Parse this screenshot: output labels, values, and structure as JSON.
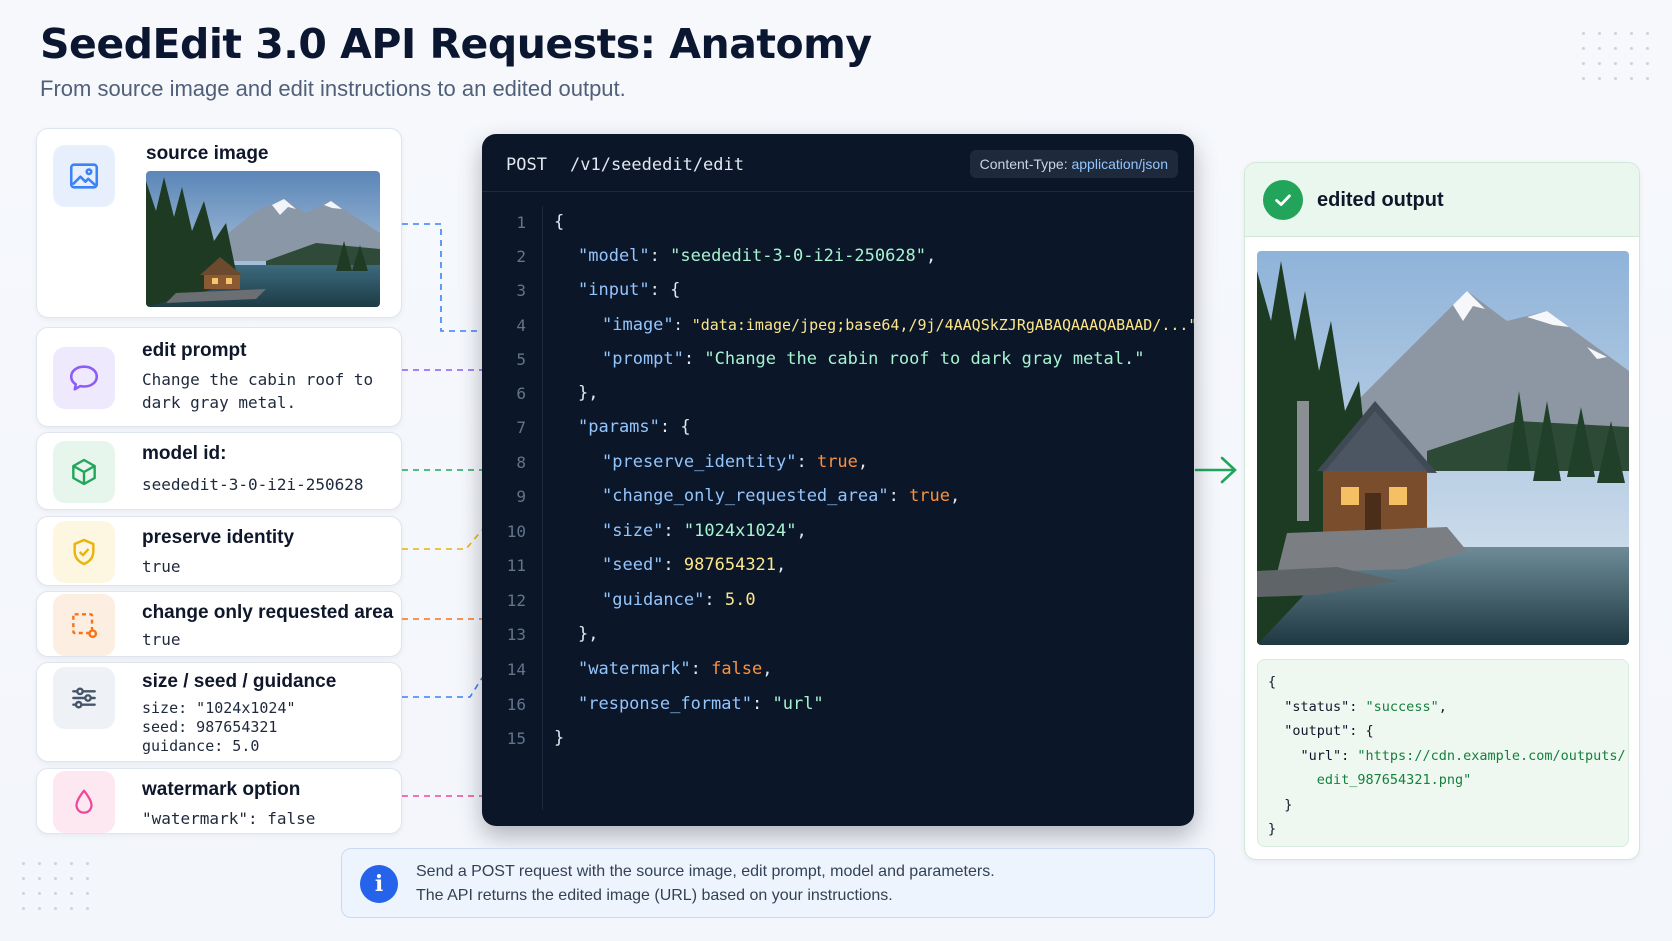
{
  "header": {
    "title": "SeedEdit 3.0 API Requests: Anatomy",
    "subtitle": "From source image and edit instructions to an edited output."
  },
  "inputs": [
    {
      "label": "source image",
      "value": "",
      "icon": "image-icon",
      "color": "#3b82f6"
    },
    {
      "label": "edit prompt",
      "value": "Change the cabin roof to\ndark gray metal.",
      "icon": "chat-bubble-icon",
      "color": "#8b5cf6"
    },
    {
      "label": "model id:",
      "value": "seededit-3-0-i2i-250628",
      "icon": "cube-icon",
      "color": "#22a55b"
    },
    {
      "label": "preserve identity",
      "value": "true",
      "icon": "shield-check-icon",
      "color": "#eab308"
    },
    {
      "label": "change only requested area",
      "value": "true",
      "icon": "crop-area-icon",
      "color": "#f97316"
    },
    {
      "label": "size / seed / guidance",
      "value": "size: \"1024x1024\"\nseed: 987654321\nguidance: 5.0",
      "icon": "sliders-icon",
      "color": "#3b82f6"
    },
    {
      "label": "watermark option",
      "value": "\"watermark\": false",
      "icon": "drop-icon",
      "color": "#ec4899"
    }
  ],
  "request": {
    "method": "POST",
    "path": "/v1/seededit/edit",
    "content_type_key": "Content-Type:",
    "content_type_val": "application/json",
    "line_numbers": [
      "1",
      "2",
      "3",
      "4",
      "5",
      "6",
      "7",
      "8",
      "9",
      "10",
      "11",
      "12",
      "13",
      "14",
      "16",
      "15"
    ]
  },
  "output": {
    "title": "edited output",
    "response": {
      "status": "success",
      "url_part1": "https://cdn.example.com/outputs/",
      "url_part2": "edit_987654321.png"
    }
  },
  "info": {
    "line1": "Send a POST request with the source image, edit prompt, model and parameters.",
    "line2": "The API returns the edited image (URL) based on your instructions."
  },
  "colors": {
    "image": "#3b82f6",
    "prompt": "#8b5cf6",
    "model": "#22a55b",
    "identity": "#eab308",
    "area": "#f97316",
    "params": "#3b82f6",
    "watermark": "#ec4899",
    "success": "#22a55b"
  }
}
